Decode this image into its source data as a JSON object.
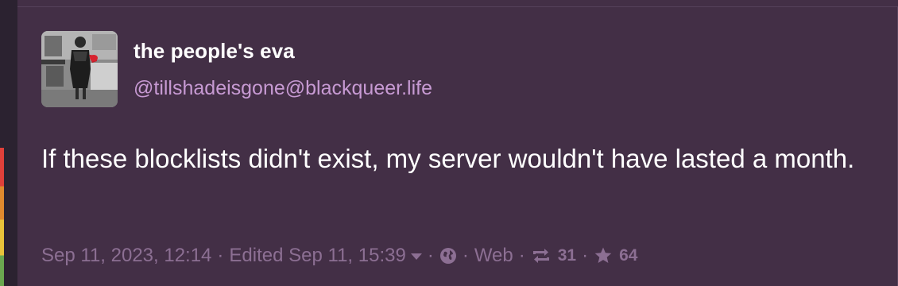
{
  "status": {
    "display_name": "the people's eva",
    "account": "@tillshadeisgone@blackqueer.life",
    "content": "If these blocklists didn't exist, my server wouldn't have lasted a month.",
    "meta": {
      "timestamp": "Sep 11, 2023, 12:14",
      "edited": "Edited Sep 11, 15:39",
      "visibility_icon": "globe-icon",
      "application": "Web",
      "reblog_icon": "boost-icon",
      "reblogs": "31",
      "favourite_icon": "star-icon",
      "favourites": "64",
      "separator": "·"
    }
  },
  "colors": {
    "card_background": "#432f46",
    "display_name": "#ffffff",
    "account": "#c79ad3",
    "meta": "#8c6f93"
  }
}
